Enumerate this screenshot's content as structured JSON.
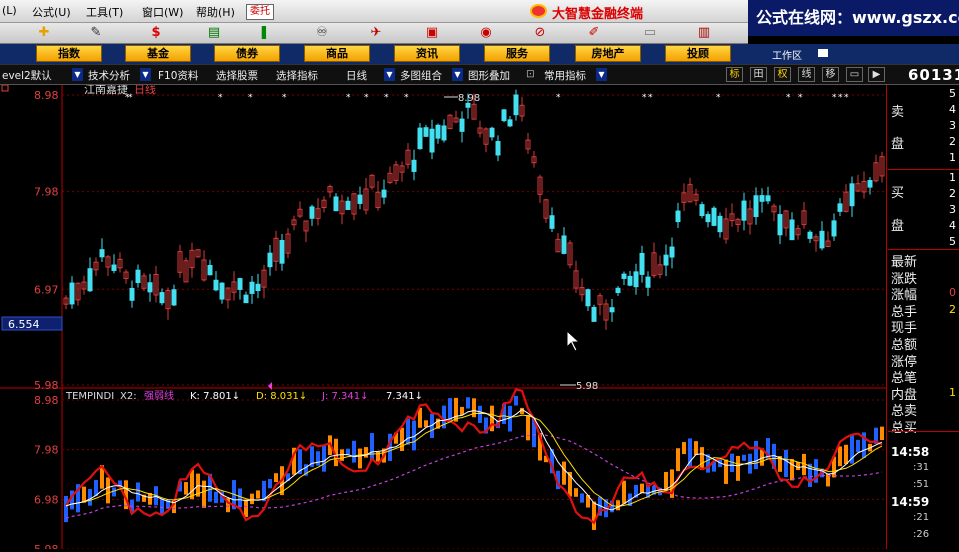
{
  "menu": {
    "items": [
      "(L)",
      "公式(U)",
      "工具(T)",
      "窗口(W)",
      "帮助(H)"
    ],
    "entrust": "委托",
    "brand": "大智慧金融终端",
    "watermark": "公式在线网：www.gszx.com.cn"
  },
  "toolbar": {
    "icons": [
      "plus-icon",
      "ruler-icon",
      "dollar-icon",
      "bar-icon",
      "money-icon",
      "binoculars-icon",
      "satellite-icon",
      "calendar-icon",
      "globe-icon",
      "nosmoking-icon",
      "note-icon",
      "monitor-icon",
      "book-icon"
    ]
  },
  "categories": [
    "指数",
    "基金",
    "债券",
    "商品",
    "资讯",
    "服务",
    "房地产",
    "投顾"
  ],
  "workarea": "工作区",
  "tabs": {
    "level": "evel2默认",
    "tech": "技术分析",
    "f10": "F10资料",
    "select_stock": "选择股票",
    "select_index": "选择指标",
    "period": "日线",
    "multi": "多图组合",
    "overlay": "图形叠加",
    "common": "常用指标",
    "modes": [
      "标",
      "田",
      "权",
      "线",
      "移"
    ],
    "stock_code": "60131"
  },
  "main_chart": {
    "stock_name": "江南嘉捷",
    "period": "日线",
    "y_labels": [
      "8.98",
      "7.98",
      "6.97",
      "5.98"
    ],
    "current_price": "6.554",
    "high_label": "8.98",
    "low_label": "5.98"
  },
  "sub_chart": {
    "indicator": "TEMPINDI",
    "x2_label": "X2:",
    "x2_name": "强弱线",
    "k": "K: 7.801↓",
    "d": "D: 8.031↓",
    "j": "J: 7.341↓",
    "extra": "7.341↓",
    "y_labels": [
      "8.98",
      "7.98",
      "6.98",
      "5.98"
    ]
  },
  "right_panel": {
    "sell_label": [
      "卖",
      "盘"
    ],
    "sell_levels": [
      "5",
      "4",
      "3",
      "2",
      "1"
    ],
    "buy_label": [
      "买",
      "盘"
    ],
    "buy_levels": [
      "1",
      "2",
      "3",
      "4",
      "5"
    ],
    "stats": [
      "最新",
      "涨跌",
      "涨幅",
      "总手",
      "现手",
      "总额",
      "涨停",
      "总笔",
      "内盘",
      "总卖",
      "总买"
    ],
    "stat_values": [
      "",
      "",
      "0",
      "2",
      "",
      "",
      "",
      "",
      "1",
      "",
      ""
    ],
    "times": [
      {
        "time": "14:58",
        "subs": [
          ":31",
          ":51"
        ]
      },
      {
        "time": "14:59",
        "subs": [
          ":21",
          ":26"
        ]
      }
    ]
  },
  "colors": {
    "up": "#d63a3a",
    "down": "#42e0f0",
    "grid": "#7a0000",
    "axis_label": "#e04040",
    "k_line": "#ffffff",
    "d_line": "#ffe000",
    "strength_line": "#e01010",
    "purple_line": "#c040e0",
    "brand": "#dd0000"
  }
}
